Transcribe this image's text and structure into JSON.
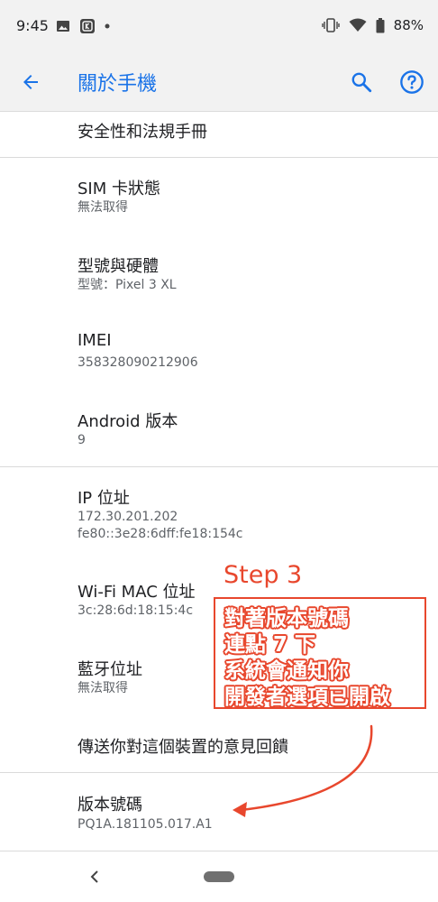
{
  "status_bar": {
    "time": "9:45",
    "battery": "88%"
  },
  "app_bar": {
    "title": "關於手機"
  },
  "items": [
    {
      "title": "安全性和法規手冊"
    },
    {
      "title": "SIM 卡狀態",
      "subtitle": "無法取得"
    },
    {
      "title": "型號與硬體",
      "subtitle": "型號：Pixel 3 XL"
    },
    {
      "title": "IMEI",
      "subtitle": "358328090212906"
    },
    {
      "title": "Android 版本",
      "subtitle": "9"
    },
    {
      "title": "IP 位址",
      "subtitle": "172.30.201.202",
      "subtitle2": "fe80::3e28:6dff:fe18:154c"
    },
    {
      "title": "Wi-Fi MAC 位址",
      "subtitle": "3c:28:6d:18:15:4c"
    },
    {
      "title": "藍牙位址",
      "subtitle": "無法取得"
    },
    {
      "title": "傳送你對這個裝置的意見回饋"
    },
    {
      "title": "版本號碼",
      "subtitle": "PQ1A.181105.017.A1"
    }
  ],
  "annotation": {
    "step": "Step 3",
    "lines": [
      "對著版本號碼",
      "連點 7 下",
      "系統會通知你",
      "開發者選項已開啟"
    ],
    "color": "#e8472d"
  },
  "colors": {
    "accent": "#1a73e8",
    "annotation": "#e8472d"
  }
}
